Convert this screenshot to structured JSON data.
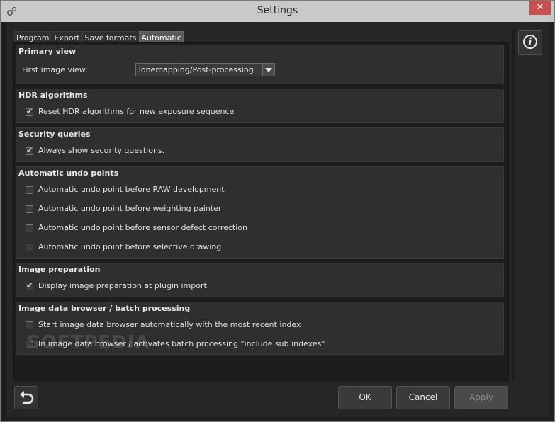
{
  "window": {
    "title": "Settings",
    "close_label": "✕"
  },
  "tabs": [
    {
      "label": "Program"
    },
    {
      "label": "Export"
    },
    {
      "label": "Save formats"
    },
    {
      "label": "Automatic",
      "active": true
    }
  ],
  "sections": {
    "primary_view": {
      "title": "Primary view",
      "first_image_label": "First image view:",
      "first_image_value": "Tonemapping/Post-processing"
    },
    "hdr": {
      "title": "HDR algorithms",
      "items": [
        {
          "label": "Reset HDR algorithms for new exposure sequence",
          "checked": true
        }
      ]
    },
    "security": {
      "title": "Security queries",
      "items": [
        {
          "label": "Always show security questions.",
          "checked": true
        }
      ]
    },
    "undo": {
      "title": "Automatic undo points",
      "items": [
        {
          "label": "Automatic undo point before RAW development",
          "checked": false
        },
        {
          "label": "Automatic undo point before weighting painter",
          "checked": false
        },
        {
          "label": "Automatic undo point before sensor defect correction",
          "checked": false
        },
        {
          "label": "Automatic undo point before selective drawing",
          "checked": false
        }
      ]
    },
    "image_prep": {
      "title": "Image preparation",
      "items": [
        {
          "label": "Display image preparation at plugin import",
          "checked": true
        }
      ]
    },
    "browser": {
      "title": "Image data browser / batch processing",
      "items": [
        {
          "label": "Start image data browser automatically with the most recent index",
          "checked": false
        },
        {
          "label": "In image data browser / activates batch processing \"include sub indexes\"",
          "checked": false
        }
      ]
    }
  },
  "buttons": {
    "ok": "OK",
    "cancel": "Cancel",
    "apply": "Apply"
  },
  "watermark": "SOFTPEDIA"
}
